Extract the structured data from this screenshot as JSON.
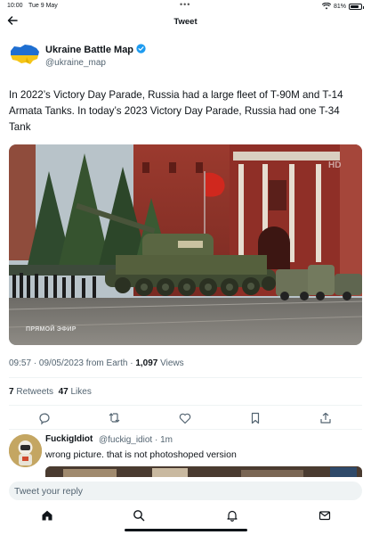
{
  "status_bar": {
    "time": "10:00",
    "date": "Tue 9 May",
    "dots": "•••",
    "battery_text": "81%",
    "battery_level": 0.81
  },
  "header": {
    "title": "Tweet",
    "back_icon": "arrow-left-icon"
  },
  "tweet": {
    "author_name": "Ukraine Battle Map",
    "author_handle": "@ukraine_map",
    "verified": true,
    "text": "In 2022’s Victory Day Parade, Russia had a large fleet of T-90M and T-14 Armata Tanks. In today’s 2023 Victory Day Parade, Russia had one T-34 Tank",
    "media_watermark": "ПРЯМОЙ ЭФИР",
    "media_corner_text": "HD",
    "time": "09:57",
    "date": "09/05/2023",
    "source": "from Earth",
    "views_count": "1,097",
    "views_label": "Views",
    "retweets_count": "7",
    "retweets_label": "Retweets",
    "likes_count": "47",
    "likes_label": "Likes"
  },
  "actions": [
    {
      "name": "reply-icon"
    },
    {
      "name": "retweet-icon"
    },
    {
      "name": "like-icon"
    },
    {
      "name": "bookmark-icon"
    },
    {
      "name": "share-icon"
    }
  ],
  "reply": {
    "author_name": "FuckigIdiot",
    "author_handle": "@fuckig_idiot · 1m",
    "text": "wrong picture. that is not photoshoped version"
  },
  "composer": {
    "placeholder": "Tweet your reply"
  },
  "bottom_nav": [
    {
      "name": "home-icon"
    },
    {
      "name": "search-icon"
    },
    {
      "name": "notifications-icon"
    },
    {
      "name": "messages-icon"
    }
  ],
  "colors": {
    "accent": "#1d9bf0",
    "text_primary": "#0f1419",
    "text_secondary": "#536471",
    "divider": "#eff3f4"
  }
}
